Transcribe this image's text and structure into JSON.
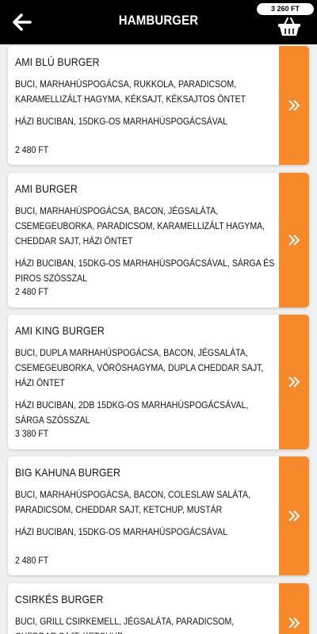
{
  "header": {
    "title": "HAMBURGER",
    "cart_total": "3 260 FT",
    "back_icon": "arrow-left-icon",
    "cart_icon": "basket-icon"
  },
  "colors": {
    "accent": "#f6892a",
    "header_bg": "#000000",
    "background": "#efefef"
  },
  "products": [
    {
      "name": "AMI BLÚ BURGER",
      "ingredients": "BUCI, MARHAHÚSPOGÁCSA, RUKKOLA, PARADICSOM, KARAMELLIZÁLT HAGYMA, KÉKSAJT, KÉKSAJTOS ÖNTET",
      "description": "HÁZI BUCIBAN, 15DKG-OS MARHAHÚSPOGÁCSÁVAL",
      "price": "2 480 FT"
    },
    {
      "name": "AMI BURGER",
      "ingredients": "BUCI, MARHAHÚSPOGÁCSA, BACON, JÉGSALÁTA, CSEMEGEUBORKA, PARADICSOM, KARAMELLIZÁLT HAGYMA, CHEDDAR SAJT, HÁZI ÖNTET",
      "description": "HÁZI BUCIBAN, 15DKG-OS MARHAHÚSPOGÁCSÁVAL, SÁRGA ÉS PIROS SZÓSSZAL",
      "price": "2 480 FT"
    },
    {
      "name": "AMI KING BURGER",
      "ingredients": "BUCI, DUPLA MARHAHÚSPOGÁCSA, BACON, JÉGSALÁTA, CSEMEGEUBORKA, VÖRÖSHAGYMA, DUPLA CHEDDAR SAJT, HÁZI ÖNTET",
      "description": "HÁZI BUCIBAN, 2DB 15DKG-OS MARHAHÚSPOGÁCSÁVAL, SÁRGA SZÓSSZAL",
      "price": "3 380 FT"
    },
    {
      "name": "BIG KAHUNA BURGER",
      "ingredients": "BUCI, MARHAHÚSPOGÁCSA, BACON, COLESLAW SALÁTA, PARADICSOM, CHEDDAR SAJT, KETCHUP, MUSTÁR",
      "description": "HÁZI BUCIBAN, 15DKG-OS MARHAHÚSPOGÁCSÁVAL",
      "price": "2 480 FT"
    },
    {
      "name": "CSIRKÉS BURGER",
      "ingredients": "BUCI, GRILL CSIRKEMELL, JÉGSALÁTA, PARADICSOM, CHEDDAR SAJT, KETCHUP",
      "description": "",
      "price": ""
    }
  ]
}
